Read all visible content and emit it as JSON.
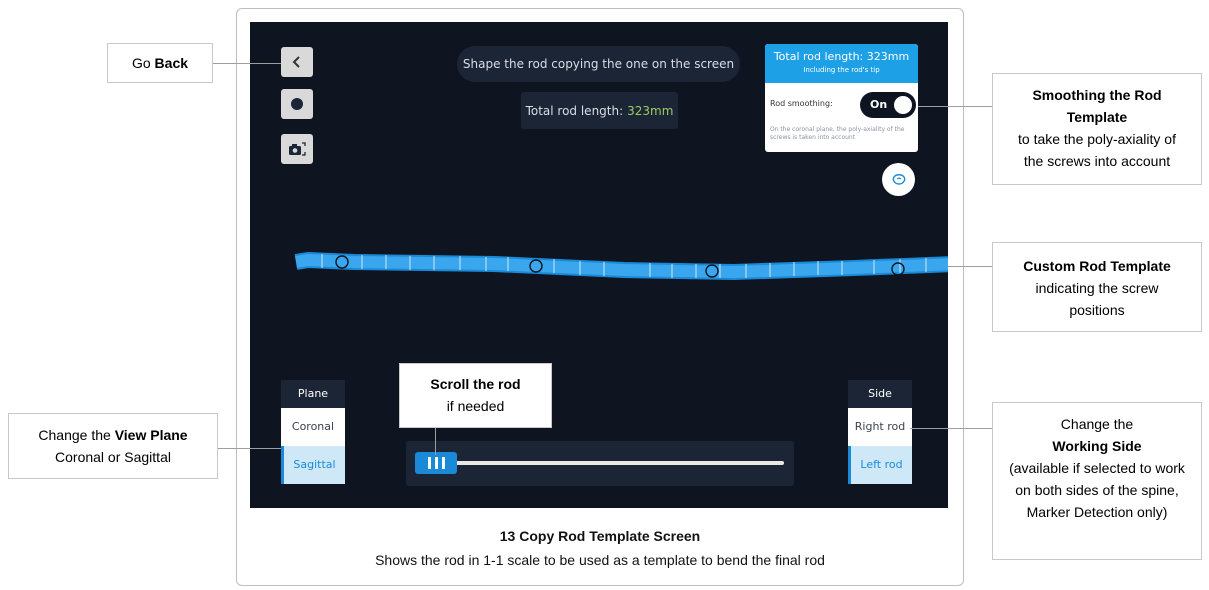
{
  "screen": {
    "instruction": "Shape the rod copying the one on the screen",
    "total_length_label": "Total rod length:",
    "total_length_value": "323mm",
    "card": {
      "title": "Total rod length: 323mm",
      "subtitle": "Including the rod's tip",
      "smoothing_label": "Rod smoothing:",
      "toggle_label": "On",
      "note": "On the coronal plane, the poly-axiality of the screws is taken into account"
    },
    "plane_panel": {
      "title": "Plane",
      "options": [
        "Coronal",
        "Sagittal"
      ],
      "selected": "Sagittal"
    },
    "side_panel": {
      "title": "Side",
      "options": [
        "Right rod",
        "Left rod"
      ],
      "selected": "Left rod"
    },
    "scroll_position": 0.05
  },
  "callouts": {
    "go_back": {
      "pre": "Go ",
      "bold": "Back"
    },
    "smoothing": {
      "bold": "Smoothing the Rod Template",
      "text": "to take the poly-axiality of the screws into account"
    },
    "custom_rod": {
      "bold": "Custom Rod Template",
      "text": "indicating the screw positions"
    },
    "view_plane": {
      "pre": "Change the ",
      "bold": "View Plane",
      "text": "Coronal or Sagittal"
    },
    "scroll": {
      "bold": "Scroll the rod",
      "text": "if needed"
    },
    "working_side": {
      "pre": "Change the",
      "bold": "Working Side",
      "text": "(available if selected to work on both sides of the spine, Marker Detection only)"
    }
  },
  "caption": {
    "title": "13 Copy Rod Template Screen",
    "subtitle": "Shows the rod in 1-1 scale to be used as a template to bend the final rod"
  },
  "colors": {
    "accent": "#1a8ad8",
    "screen_bg": "#0e1521",
    "panel_dark": "#1b2536",
    "highlight_green": "#9ccc65"
  }
}
